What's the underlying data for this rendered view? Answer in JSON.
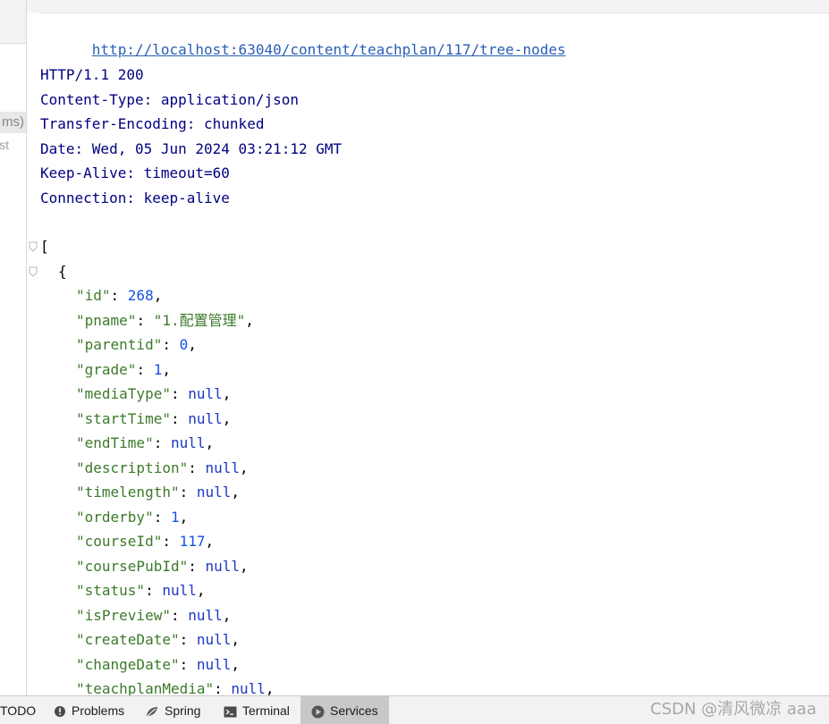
{
  "left_panel": {
    "selected_fragment": "ms)",
    "fragment2": "st"
  },
  "request": {
    "url": "http://localhost:63040/content/teachplan/117/tree-nodes"
  },
  "response_headers": [
    "HTTP/1.1 200",
    "Content-Type: application/json",
    "Transfer-Encoding: chunked",
    "Date: Wed, 05 Jun 2024 03:21:12 GMT",
    "Keep-Alive: timeout=60",
    "Connection: keep-alive"
  ],
  "json_body": {
    "open_bracket": "[",
    "open_brace": "{",
    "fields": [
      {
        "key": "\"id\"",
        "value": "268",
        "type": "num"
      },
      {
        "key": "\"pname\"",
        "value": "\"1.配置管理\"",
        "type": "str"
      },
      {
        "key": "\"parentid\"",
        "value": "0",
        "type": "num"
      },
      {
        "key": "\"grade\"",
        "value": "1",
        "type": "num"
      },
      {
        "key": "\"mediaType\"",
        "value": "null",
        "type": "kw"
      },
      {
        "key": "\"startTime\"",
        "value": "null",
        "type": "kw"
      },
      {
        "key": "\"endTime\"",
        "value": "null",
        "type": "kw"
      },
      {
        "key": "\"description\"",
        "value": "null",
        "type": "kw"
      },
      {
        "key": "\"timelength\"",
        "value": "null",
        "type": "kw"
      },
      {
        "key": "\"orderby\"",
        "value": "1",
        "type": "num"
      },
      {
        "key": "\"courseId\"",
        "value": "117",
        "type": "num"
      },
      {
        "key": "\"coursePubId\"",
        "value": "null",
        "type": "kw"
      },
      {
        "key": "\"status\"",
        "value": "null",
        "type": "kw"
      },
      {
        "key": "\"isPreview\"",
        "value": "null",
        "type": "kw"
      },
      {
        "key": "\"createDate\"",
        "value": "null",
        "type": "kw"
      },
      {
        "key": "\"changeDate\"",
        "value": "null",
        "type": "kw"
      },
      {
        "key": "\"teachplanMedia\"",
        "value": "null",
        "type": "kw"
      }
    ]
  },
  "bottom_bar": {
    "tabs": [
      {
        "label": "TODO",
        "icon": "todo-icon",
        "active": false
      },
      {
        "label": "Problems",
        "icon": "problems-icon",
        "active": false
      },
      {
        "label": "Spring",
        "icon": "spring-icon",
        "active": false
      },
      {
        "label": "Terminal",
        "icon": "terminal-icon",
        "active": false
      },
      {
        "label": "Services",
        "icon": "services-icon",
        "active": true
      }
    ]
  },
  "watermark": "CSDN @清风微凉 aaa",
  "colors": {
    "header_text": "#000080",
    "json_key": "#3c7a2a",
    "json_number": "#1750eb",
    "json_null": "#1c38c4",
    "url": "#2a5eb6"
  }
}
